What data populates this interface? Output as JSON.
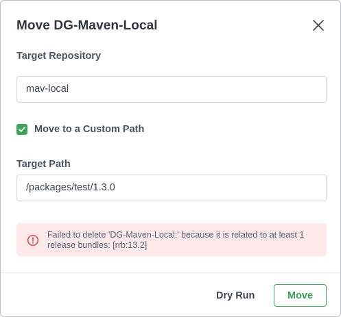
{
  "dialog": {
    "title": "Move DG-Maven-Local",
    "close_icon": "close-icon"
  },
  "form": {
    "target_repository": {
      "label": "Target Repository",
      "value": "mav-local"
    },
    "custom_path": {
      "label": "Move to a Custom Path",
      "checked": true
    },
    "target_path": {
      "label": "Target Path",
      "value": "/packages/test/1.3.0"
    }
  },
  "alert": {
    "icon": "error-circle-icon",
    "message": "Failed to delete 'DG-Maven-Local:' because it is related to at least 1 release bundles: [rrb:13.2]"
  },
  "footer": {
    "dry_run_label": "Dry Run",
    "move_label": "Move"
  },
  "colors": {
    "accent_green": "#43a45e",
    "alert_background": "#fde9ea",
    "alert_icon": "#d64552"
  }
}
